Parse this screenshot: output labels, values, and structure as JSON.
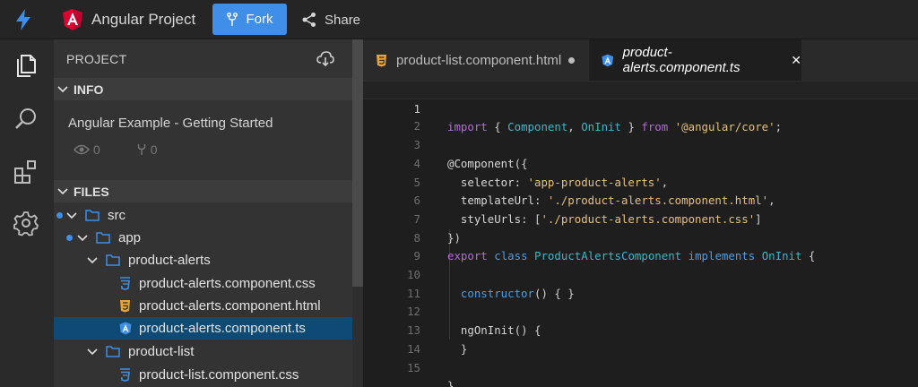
{
  "topbar": {
    "project_title": "Angular Project",
    "fork_label": "Fork",
    "share_label": "Share"
  },
  "sidebar": {
    "header": "PROJECT",
    "info_section": "INFO",
    "info_title": "Angular Example - Getting Started",
    "views": "0",
    "forks": "0",
    "files_section": "FILES",
    "tree": [
      {
        "label": "src",
        "type": "folder"
      },
      {
        "label": "app",
        "type": "folder"
      },
      {
        "label": "product-alerts",
        "type": "folder"
      },
      {
        "label": "product-alerts.component.css",
        "type": "css"
      },
      {
        "label": "product-alerts.component.html",
        "type": "html"
      },
      {
        "label": "product-alerts.component.ts",
        "type": "ts",
        "active": true
      },
      {
        "label": "product-list",
        "type": "folder"
      },
      {
        "label": "product-list.component.css",
        "type": "css"
      }
    ]
  },
  "tabs": [
    {
      "label": "product-list.component.html",
      "modified": true
    },
    {
      "label": "product-alerts.component.ts",
      "active": true
    }
  ],
  "editor": {
    "line_numbers": [
      "1",
      "2",
      "3",
      "4",
      "5",
      "6",
      "7",
      "8",
      "9",
      "10",
      "11",
      "12",
      "13",
      "14",
      "15"
    ],
    "lines": [
      "import { Component, OnInit } from '@angular/core';",
      "",
      "@Component({",
      "  selector: 'app-product-alerts',",
      "  templateUrl: './product-alerts.component.html',",
      "  styleUrls: ['./product-alerts.component.css']",
      "})",
      "export class ProductAlertsComponent implements OnInit {",
      "",
      "  constructor() { }",
      "",
      "  ngOnInit() {",
      "  }",
      "",
      "}"
    ]
  },
  "colors": {
    "accent": "#3f8ee8",
    "active_row": "#0e4a74",
    "angular_red": "#dd0031",
    "html_orange": "#e8a33c"
  }
}
